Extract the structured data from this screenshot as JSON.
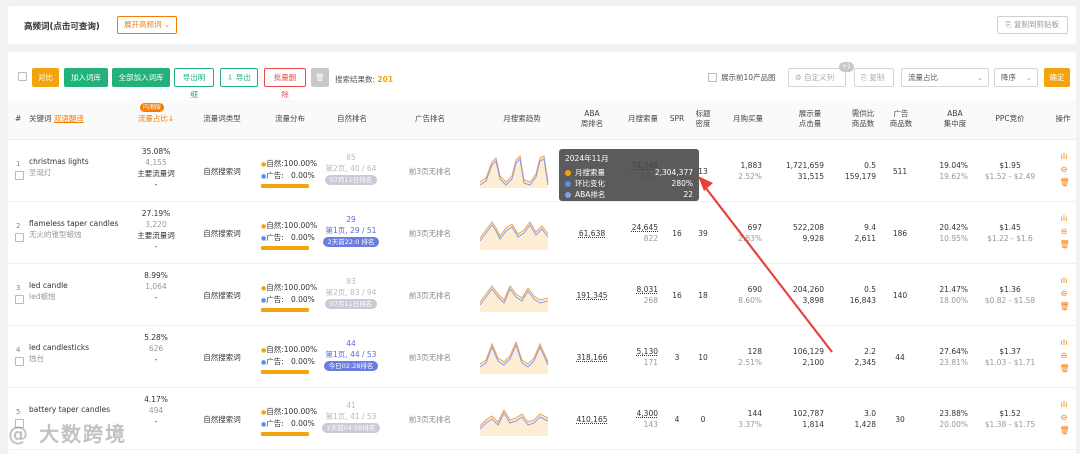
{
  "header": {
    "title": "高频词(点击可查询)",
    "expand_label": "展开高频词",
    "copy_label": "复制到剪贴板"
  },
  "toolbar": {
    "compare_label": "对比",
    "add_lib_label": "加入词库",
    "add_all_label": "全部加入词库",
    "export_detail_label": "导出明细",
    "export_label": "导出",
    "batch_delete_label": "批量删除",
    "result_label": "搜索结果数:",
    "result_count": "201",
    "top10_label": "展示前10产品图",
    "custom_col_label": "自定义列",
    "custom_badge": "+1",
    "copy_label": "复制",
    "sort_field": "流量占比",
    "sort_order": "降序",
    "confirm_label": "确定"
  },
  "columns": {
    "idx": "#",
    "keyword": "关键词",
    "translate": "双语翻译",
    "share_tag": "内测版",
    "share": "流量占比",
    "type": "流量词类型",
    "dist": "流量分布",
    "natural": "自然排名",
    "ad": "广告排名",
    "trend": "月搜索趋势",
    "aba_week": "ABA\n周排名",
    "monthly_search": "月搜索量",
    "spr": "SPR",
    "title_density": "标题\n密度",
    "monthly_buy": "月购买量",
    "click_label": "展示量\n点击量",
    "supply": "需供比\n商品数",
    "ad_products": "广告\n商品数",
    "aba_conc": "ABA\n集中度",
    "ppc": "PPC竞价",
    "ops": "操作"
  },
  "rows": [
    {
      "idx": "1",
      "kw": "christmas lights",
      "kw_cn": "圣诞灯",
      "share": "35.08%",
      "share_cnt": "4,155",
      "flow_type": "主要流量词",
      "flow_type2": "-",
      "type": "自然搜索词",
      "natural_pct": "100.00%",
      "ad_pct": "0.00%",
      "natural_pct_num": 100,
      "rank_main": "85",
      "rank_sub": "第2页, 40 / 64",
      "rank_pill": "07月11日排名",
      "rank_faded": true,
      "ad_rank": "前3页无排名",
      "aba": "",
      "ms": "74,748",
      "ms2": "2,4…",
      "spr": "",
      "td": "13",
      "buy": "1,883",
      "buy2": "2.52%",
      "imp": "1,721,659",
      "clk": "31,515",
      "sup": "0.5",
      "sup2": "159,179",
      "adp": "511",
      "conc": "19.04%",
      "conc2": "19.62%",
      "ppc": "$1.95",
      "ppc2": "$1.52 - $2.49"
    },
    {
      "idx": "2",
      "kw": "flameless taper candles",
      "kw_cn": "无火的锥型蜡烛",
      "share": "27.19%",
      "share_cnt": "3,220",
      "flow_type": "主要流量词",
      "flow_type2": "-",
      "type": "自然搜索词",
      "natural_pct": "100.00%",
      "ad_pct": "0.00%",
      "natural_pct_num": 100,
      "rank_main": "29",
      "rank_sub": "第1页, 29 / 51",
      "rank_pill": "2天前22:0 排名",
      "rank_faded": false,
      "ad_rank": "前3页无排名",
      "aba": "61,638",
      "ms": "24,645",
      "ms2": "822",
      "spr": "16",
      "td": "39",
      "buy": "697",
      "buy2": "2.83%",
      "imp": "522,208",
      "clk": "9,928",
      "sup": "9.4",
      "sup2": "2,611",
      "adp": "186",
      "conc": "20.42%",
      "conc2": "10.95%",
      "ppc": "$1.45",
      "ppc2": "$1.22 - $1.6"
    },
    {
      "idx": "3",
      "kw": "led candle",
      "kw_cn": "led蜡烛",
      "share": "8.99%",
      "share_cnt": "1,064",
      "flow_type": "-",
      "flow_type2": "",
      "type": "自然搜索词",
      "natural_pct": "100.00%",
      "ad_pct": "0.00%",
      "natural_pct_num": 100,
      "rank_main": "83",
      "rank_sub": "第2页, 83 / 94",
      "rank_pill": "07月11日排名",
      "rank_faded": true,
      "ad_rank": "前3页无排名",
      "aba": "191,345",
      "ms": "8,031",
      "ms2": "268",
      "spr": "16",
      "td": "18",
      "buy": "690",
      "buy2": "8.60%",
      "imp": "204,260",
      "clk": "3,898",
      "sup": "0.5",
      "sup2": "16,843",
      "adp": "140",
      "conc": "21.47%",
      "conc2": "18.00%",
      "ppc": "$1.36",
      "ppc2": "$0.82 - $1.58"
    },
    {
      "idx": "4",
      "kw": "led candlesticks",
      "kw_cn": "烛台",
      "share": "5.28%",
      "share_cnt": "626",
      "flow_type": "-",
      "flow_type2": "",
      "type": "自然搜索词",
      "natural_pct": "100.00%",
      "ad_pct": "0.00%",
      "natural_pct_num": 100,
      "rank_main": "44",
      "rank_sub": "第1页, 44 / 53",
      "rank_pill": "今日02:28排名",
      "rank_faded": false,
      "ad_rank": "前3页无排名",
      "aba": "318,166",
      "ms": "5,130",
      "ms2": "171",
      "spr": "3",
      "td": "10",
      "buy": "128",
      "buy2": "2.51%",
      "imp": "106,129",
      "clk": "2,100",
      "sup": "2.2",
      "sup2": "2,345",
      "adp": "44",
      "conc": "27.64%",
      "conc2": "23.81%",
      "ppc": "$1.37",
      "ppc2": "$1.03 - $1.71"
    },
    {
      "idx": "5",
      "kw": "battery taper candles",
      "kw_cn": "",
      "share": "4.17%",
      "share_cnt": "494",
      "flow_type": "-",
      "flow_type2": "",
      "type": "自然搜索词",
      "natural_pct": "100.00%",
      "ad_pct": "0.00%",
      "natural_pct_num": 100,
      "rank_main": "41",
      "rank_sub": "第1页, 41 / 53",
      "rank_pill": "2天前04:58排名",
      "rank_faded": true,
      "ad_rank": "前3页无排名",
      "aba": "410,165",
      "ms": "4,300",
      "ms2": "143",
      "spr": "4",
      "td": "0",
      "buy": "144",
      "buy2": "3.37%",
      "imp": "102,787",
      "clk": "1,814",
      "sup": "3.0",
      "sup2": "1,428",
      "adp": "30",
      "conc": "23.88%",
      "conc2": "20.00%",
      "ppc": "$1.52",
      "ppc2": "$1.38 - $1.75"
    }
  ],
  "dist_labels": {
    "natural": "自然:",
    "ad": "广告:"
  },
  "tooltip": {
    "title": "2024年11月",
    "items": [
      {
        "label": "月搜索量",
        "value": "2,304,377",
        "color": "#f5a30c"
      },
      {
        "label": "环比变化",
        "value": "280%",
        "color": "#5a8dee"
      },
      {
        "label": "ABA排名",
        "value": "22",
        "color": "#8a9af0"
      }
    ]
  },
  "colors": {
    "accent": "#f5a30c",
    "green": "#20b27a",
    "red": "#e94a4a",
    "blue": "#5a6bd8"
  },
  "watermark": "@ 大数跨境"
}
